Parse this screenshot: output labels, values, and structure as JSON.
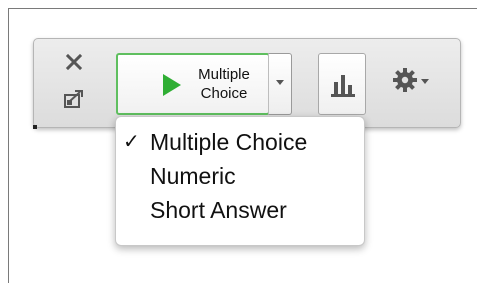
{
  "toolbar": {
    "close_icon": "close-icon",
    "export_icon": "export-icon",
    "start_button": {
      "label_line1": "Multiple",
      "label_line2": "Choice",
      "accent_color": "#2fae34"
    },
    "chart_icon": "bar-chart-icon",
    "settings_icon": "gear-icon"
  },
  "question_type_menu": {
    "items": [
      {
        "check": "✓",
        "label": "Multiple Choice",
        "selected": true
      },
      {
        "check": "",
        "label": "Numeric",
        "selected": false
      },
      {
        "check": "",
        "label": "Short Answer",
        "selected": false
      }
    ]
  }
}
